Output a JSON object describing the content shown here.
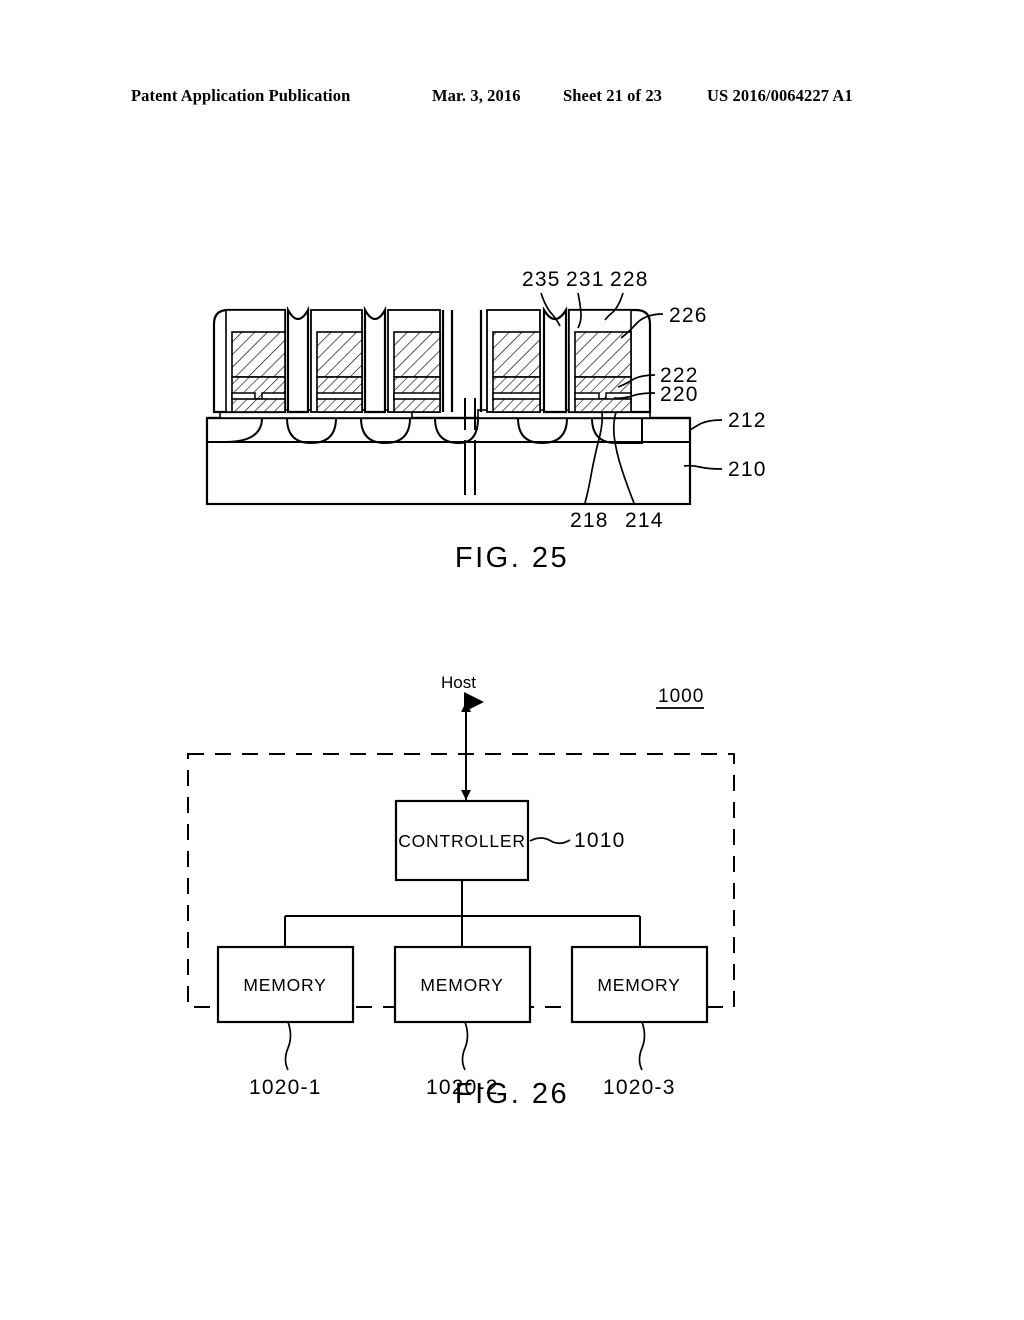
{
  "header": {
    "publication": "Patent Application Publication",
    "date": "Mar. 3, 2016",
    "sheet": "Sheet 21 of 23",
    "patent_number": "US 2016/0064227 A1"
  },
  "figure_25": {
    "caption": "FIG. 25",
    "reference_numerals": {
      "n235": "235",
      "n231": "231",
      "n228": "228",
      "n226": "226",
      "n222": "222",
      "n220": "220",
      "n212": "212",
      "n210": "210",
      "n218": "218",
      "n214": "214"
    }
  },
  "figure_26": {
    "caption": "FIG. 26",
    "host_label": "Host",
    "system_numeral": "1000",
    "controller": {
      "label": "CONTROLLER",
      "numeral": "1010"
    },
    "memories": [
      {
        "label": "MEMORY",
        "numeral": "1020-1"
      },
      {
        "label": "MEMORY",
        "numeral": "1020-2"
      },
      {
        "label": "MEMORY",
        "numeral": "1020-3"
      }
    ]
  },
  "colors": {
    "ink": "#000000",
    "paper": "#ffffff"
  }
}
